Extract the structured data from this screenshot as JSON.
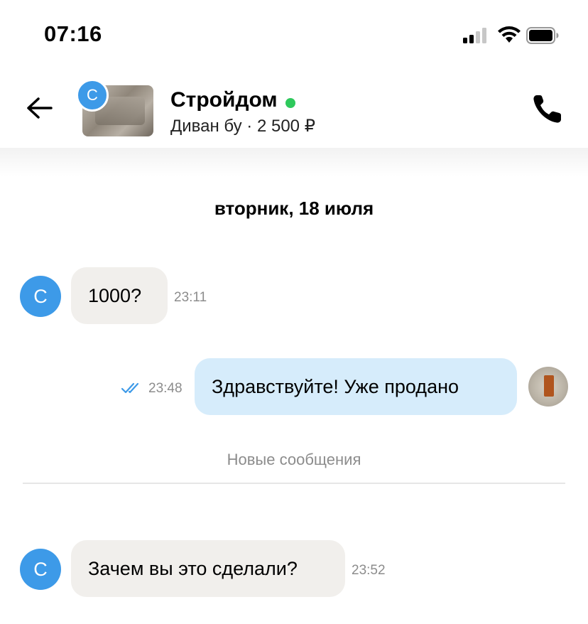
{
  "status_bar": {
    "time": "07:16"
  },
  "header": {
    "thumb_letter": "С",
    "seller_name": "Стройдом",
    "item": "Диван бу",
    "price": "2 500 ₽",
    "sub_separator": " · "
  },
  "chat": {
    "date": "вторник, 18 июля",
    "new_messages_label": "Новые сообщения",
    "messages": [
      {
        "from": "seller",
        "avatar_letter": "С",
        "text": "1000?",
        "time": "23:11"
      },
      {
        "from": "me",
        "text": "Здравствуйте! Уже продано",
        "time": "23:48",
        "status": "read"
      },
      {
        "from": "seller",
        "avatar_letter": "С",
        "text": "Зачем вы это сделали?",
        "time": "23:52"
      }
    ]
  },
  "colors": {
    "accent_blue": "#3d9ae8",
    "online_green": "#2ec95c",
    "incoming_bubble": "#f1efec",
    "outgoing_bubble": "#d6ecfb"
  }
}
